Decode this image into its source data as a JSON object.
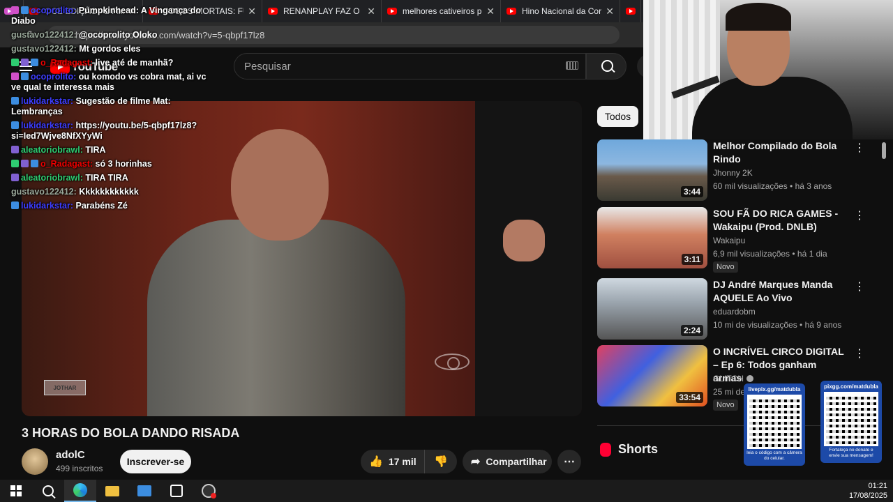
{
  "browser": {
    "tabs": [
      {
        "label": "OCE EDIÇÃO - 2 Filme"
      },
      {
        "label": "JOGOS MORTAIS: FUNI"
      },
      {
        "label": "RENANPLAY FAZ O IMP"
      },
      {
        "label": "melhores cativeiros pra"
      },
      {
        "label": "Hino Nacional da Coré"
      }
    ],
    "url": "https://www.youtube.com/watch?v=5-qbpf17lz8"
  },
  "youtube": {
    "logo_text": "YouTube",
    "search_placeholder": "Pesquisar"
  },
  "chat": [
    {
      "user": "ocoprolito:",
      "color": "blue",
      "badges": [
        "pink",
        "blue"
      ],
      "text": "Pumpkinhead: A Vingança do Diabo"
    },
    {
      "user": "gustavo122412:",
      "color": "grey",
      "badges": [],
      "text": "@ocoprolito Oloko"
    },
    {
      "user": "gustavo122412:",
      "color": "grey",
      "badges": [],
      "text": "Mt gordos eles"
    },
    {
      "user": "o_Radagast:",
      "color": "red",
      "badges": [
        "green",
        "purple",
        "blue"
      ],
      "text": "live até de manhã?"
    },
    {
      "user": "ocoprolito:",
      "color": "blue",
      "badges": [
        "pink",
        "blue"
      ],
      "text": "ou komodo vs cobra mat, ai vc ve qual te interessa mais"
    },
    {
      "user": "lukidarkstar:",
      "color": "blue",
      "badges": [
        "blue"
      ],
      "text": "Sugestão de filme Mat: Lembranças"
    },
    {
      "user": "lukidarkstar:",
      "color": "blue",
      "badges": [
        "blue"
      ],
      "text": "https://youtu.be/5-qbpf17lz8?si=Ied7Wjve8NfXYyWi"
    },
    {
      "user": "aleatoriobrawl:",
      "color": "green",
      "badges": [
        "purple"
      ],
      "text": "TIRA"
    },
    {
      "user": "o_Radagast:",
      "color": "red",
      "badges": [
        "green",
        "purple",
        "blue"
      ],
      "text": "só 3 horinhas"
    },
    {
      "user": "aleatoriobrawl:",
      "color": "green",
      "badges": [
        "purple"
      ],
      "text": "TIRA TIRA"
    },
    {
      "user": "gustavo122412:",
      "color": "grey",
      "badges": [],
      "text": "Kkkkkkkkkkkk"
    },
    {
      "user": "lukidarkstar:",
      "color": "blue",
      "badges": [
        "blue"
      ],
      "text": "Parabéns Zé"
    }
  ],
  "video": {
    "title": "3 HORAS DO BOLA DANDO RISADA",
    "watermark": "JOTHAR",
    "channel": "adolC",
    "subscribers": "499 inscritos",
    "subscribe_label": "Inscrever-se",
    "likes": "17 mil",
    "share_label": "Compartilhar"
  },
  "sidebar": {
    "chip": "Todos",
    "recommendations": [
      {
        "title": "Melhor Compilado do Bola Rindo",
        "channel": "Jhonny 2K",
        "meta": "60 mil visualizações • há 3 anos",
        "duration": "3:44",
        "badge": ""
      },
      {
        "title": "SOU FÃ DO RICA GAMES - Wakaipu (Prod. DNLB)",
        "channel": "Wakaipu",
        "meta": "6,9 mil visualizações • há 1 dia",
        "duration": "3:11",
        "badge": "Novo"
      },
      {
        "title": "DJ André Marques Manda AQUELE Ao Vivo",
        "channel": "eduardobm",
        "meta": "10 mi de visualizações • há 9 anos",
        "duration": "2:24",
        "badge": ""
      },
      {
        "title": "O INCRÍVEL CIRCO DIGITAL – Ep 6: Todos ganham armas",
        "channel": "GLITCH",
        "meta": "25 mi de",
        "duration": "33:54",
        "badge": "Novo"
      }
    ],
    "shorts_label": "Shorts"
  },
  "overlays": {
    "qr_left_top": "livepix.gg/matdubla",
    "qr_left_bottom": "leia o código com a câmera do celular.",
    "qr_right_top": "pixgg.com/matdubla",
    "qr_right_bottom": "Fortaleça no donate e envie sua mensagem!"
  },
  "taskbar": {
    "time": "01:21",
    "date": "17/08/2025"
  },
  "colors": {
    "youtube_red": "#ff0000",
    "background": "#0f0f0f",
    "chat_blue": "#3d3dff",
    "chat_green": "#2ecc71",
    "chat_red": "#e00000"
  }
}
